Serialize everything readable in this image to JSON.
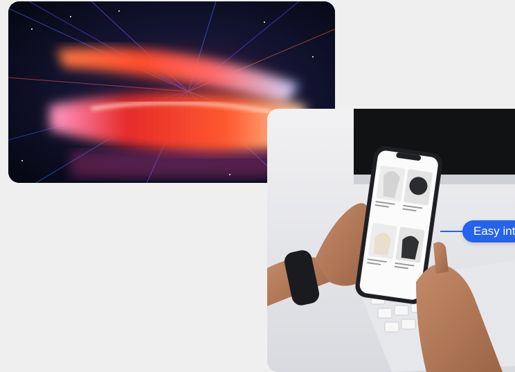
{
  "callout": {
    "label": "Easy int"
  },
  "colors": {
    "page_background": "#efefef",
    "accent": "#2563eb"
  }
}
